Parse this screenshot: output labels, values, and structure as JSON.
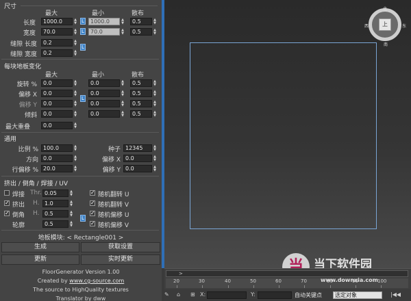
{
  "size_section": {
    "title": "尺寸",
    "col_headers": [
      "最大",
      "最小",
      "散布"
    ],
    "rows": [
      {
        "label": "长度",
        "max": "1000.0",
        "min": "1000.0",
        "spread": "0.5"
      },
      {
        "label": "宽度",
        "max": "70.0",
        "min": "70.0",
        "spread": "0.5"
      }
    ],
    "seam_length_label": "缝隙 长度",
    "seam_length": "0.2",
    "seam_width_label": "缝隙 宽度",
    "seam_width": "0.2"
  },
  "variation_section": {
    "title": "每块地板变化",
    "col_headers": [
      "最大",
      "最小",
      "散布"
    ],
    "rows": [
      {
        "label": "旋转 %",
        "max": "0.0",
        "min": "0.0",
        "spread": "0.5"
      },
      {
        "label": "偏移 X",
        "max": "0.0",
        "min": "0.0",
        "spread": "0.5"
      },
      {
        "label": "偏移 Y",
        "max": "0.0",
        "min": "0.0",
        "spread": "0.5"
      },
      {
        "label": "倾斜",
        "max": "0.0",
        "min": "0.0",
        "spread": "0.5"
      }
    ],
    "max_overlap_label": "最大重叠",
    "max_overlap": "0.0"
  },
  "general_section": {
    "title": "通用",
    "scale_label": "比例 %",
    "scale": "100.0",
    "seed_label": "种子",
    "seed": "12345",
    "direction_label": "方向",
    "direction": "0.0",
    "offset_x_label": "偏移 X",
    "offset_x": "0.0",
    "row_offset_label": "行偏移 %",
    "row_offset": "20.0",
    "offset_y_label": "偏移 Y",
    "offset_y": "0.0"
  },
  "bevel_section": {
    "title": "挤出 / 倒角 / 焊接 / UV",
    "weld_label": "焊接",
    "weld_sub": "Thr.",
    "weld": "0.05",
    "extrude_label": "挤出",
    "extrude_sub": "H.",
    "extrude": "1.0",
    "bevel_label": "倒角",
    "bevel_sub": "H.",
    "bevel": "0.5",
    "contour_label": "轮廓",
    "contour": "0.5",
    "random_flip_u": "随机翻转 U",
    "random_flip_v": "随机翻转 V",
    "random_offset_u": "随机偏移 U",
    "random_offset_v": "随机偏移 V"
  },
  "module_label": "地板模块: < Rectangle001 >",
  "buttons": {
    "generate": "生成",
    "get_settings": "获取设置",
    "update": "更新",
    "realtime_update": "实时更新"
  },
  "info": {
    "version": "FloorGenerator Version 1.00",
    "created_prefix": "Created by",
    "created_link": "www.cg-source.com",
    "source_line": "The source to HighQuality textures",
    "translator": "Translator by dww"
  },
  "viewcube": {
    "face": "上",
    "north": "北",
    "south": "南",
    "east": "东",
    "west": "西"
  },
  "timeline": {
    "scrub_arrow": ">",
    "ticks": [
      "20",
      "30",
      "40",
      "50",
      "60",
      "70",
      "80",
      "90",
      "100"
    ]
  },
  "statusbar": {
    "x_label": "X:",
    "y_label": "Y:",
    "autokey_label": "自动关键点",
    "selection_value": "选定对象"
  },
  "watermark": {
    "logo": "当",
    "text": "当下软件园",
    "url": "www.downxia.com"
  },
  "colors": {
    "accent": "#3d82c7",
    "divider": "#2f6fb7",
    "rectangle": "#7aa6d6"
  }
}
